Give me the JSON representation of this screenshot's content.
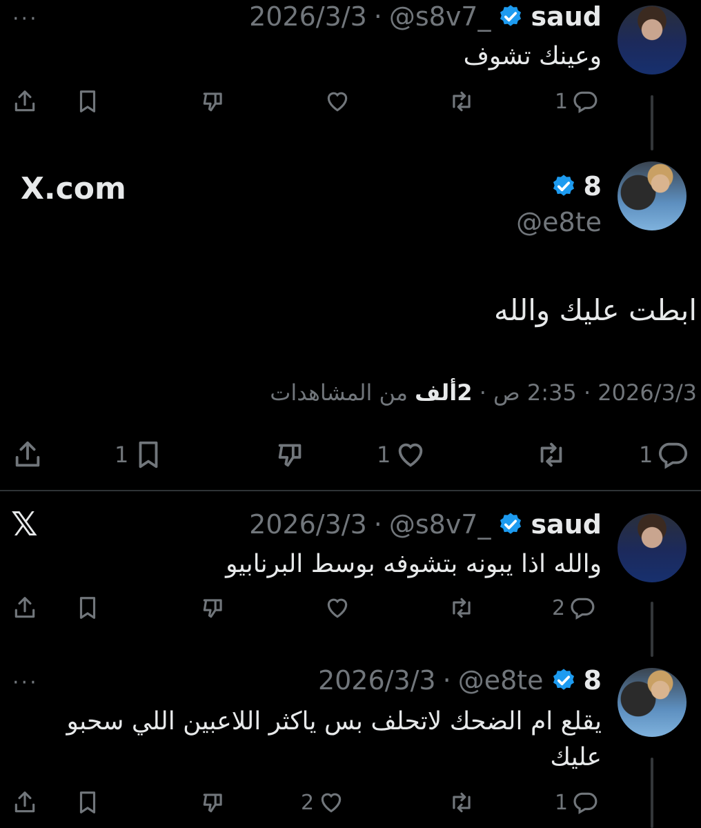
{
  "tweet1": {
    "name": "saud",
    "handle": "@s8v7_",
    "separator": "·",
    "date": "2026/3/3",
    "text": "وعينك تشوف",
    "more": "···",
    "reply_count": "1"
  },
  "main_tweet": {
    "name": "8",
    "handle": "@e8te",
    "watermark": "X.com",
    "text": "ابطت عليك والله",
    "timestamp": "2026/3/3 · 2:35 ص · ",
    "views_count": "2ألف",
    "views_label": " من المشاهدات",
    "reply_count": "1",
    "like_count": "1",
    "bookmark_count": "1"
  },
  "tweet3": {
    "logo": "𝕏",
    "name": "saud",
    "handle": "@s8v7_",
    "separator": "·",
    "date": "2026/3/3",
    "text": "والله اذا يبونه بتشوفه بوسط البرنابيو",
    "reply_count": "2"
  },
  "tweet4": {
    "name": "8",
    "handle": "@e8te",
    "separator": "·",
    "date": "2026/3/3",
    "text": "يقلع ام الضحك لاتحلف بس ياكثر اللاعبين اللي سحبو عليك",
    "more": "···",
    "reply_count": "1",
    "like_count": "2"
  },
  "colors": {
    "background": "#000000",
    "text": "#e7e9ea",
    "muted": "#71767b",
    "verified": "#1d9bf0"
  },
  "icons": [
    "reply-icon",
    "retweet-icon",
    "like-icon",
    "dislike-icon",
    "bookmark-icon",
    "share-icon",
    "verified-icon",
    "more-icon"
  ]
}
